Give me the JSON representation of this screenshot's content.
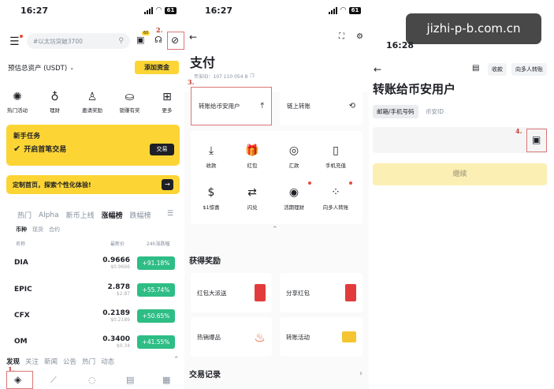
{
  "watermark": "jizhi-p-b.com.cn",
  "panel1": {
    "time": "16:27",
    "battery": "61",
    "search_placeholder": "#以太坊突破3700",
    "badge": "60",
    "step2": "2.",
    "assets_label": "预估总资产 (USDT)",
    "add_funds": "添加资金",
    "quick": [
      "热门活动",
      "理财",
      "邀请奖励",
      "锁赚有奖",
      "更多"
    ],
    "quick_icons": [
      "party-icon",
      "bag-icon",
      "person-icon",
      "piggy-icon",
      "grid-icon"
    ],
    "task_title": "新手任务",
    "task_sub": "开启首笔交易",
    "task_btn": "交易",
    "banner_text": "定制首页，探索个性化体验!",
    "tabs": [
      "热门",
      "Alpha",
      "新币上线",
      "涨幅榜",
      "跌幅榜"
    ],
    "subtabs": [
      "币种",
      "现货",
      "合约"
    ],
    "col_name": "名称",
    "col_price": "最新价",
    "col_change": "24h涨跌幅",
    "rows": [
      {
        "sym": "DIA",
        "price": "0.9666",
        "sub": "$0.9666",
        "change": "+91.18%"
      },
      {
        "sym": "EPIC",
        "price": "2.878",
        "sub": "$2.87",
        "change": "+55.74%"
      },
      {
        "sym": "CFX",
        "price": "0.2189",
        "sub": "$0.2189",
        "change": "+50.65%"
      },
      {
        "sym": "OM",
        "price": "0.3400",
        "sub": "$0.34",
        "change": "+41.55%"
      }
    ],
    "bottom_tabs": [
      "发现",
      "关注",
      "新闻",
      "公告",
      "热门",
      "动态"
    ],
    "step1": "1."
  },
  "panel2": {
    "time": "16:27",
    "battery": "61",
    "title": "支付",
    "pay_id": "币安ID：107 110 054 8",
    "step3": "3.",
    "transfer_binance": "转账给币安用户",
    "onchain": "链上转账",
    "grid": [
      {
        "label": "收款",
        "icon": "download-icon",
        "glyph": "⤓"
      },
      {
        "label": "红包",
        "icon": "gift-icon",
        "glyph": "🎁"
      },
      {
        "label": "汇款",
        "icon": "remit-icon",
        "glyph": "◎"
      },
      {
        "label": "手机充值",
        "icon": "phone-icon",
        "glyph": "▯"
      },
      {
        "label": "$1惊喜",
        "icon": "dollar-icon",
        "glyph": "$"
      },
      {
        "label": "闪兑",
        "icon": "swap-icon",
        "glyph": "⇄"
      },
      {
        "label": "活期理财",
        "icon": "coin-icon",
        "glyph": "◉"
      },
      {
        "label": "向多人转账",
        "icon": "multi-icon",
        "glyph": "⁘"
      }
    ],
    "rewards_title": "获得奖励",
    "rewards": [
      "红包大派送",
      "分享红包",
      "热销爆品",
      "转账活动"
    ],
    "history": "交易记录"
  },
  "panel3": {
    "time": "16:28",
    "receive": "收款",
    "multi": "向多人转账",
    "title": "转账给币安用户",
    "tab_email": "邮箱/手机号码",
    "tab_id": "币安ID",
    "step4": "4.",
    "continue": "继续"
  }
}
